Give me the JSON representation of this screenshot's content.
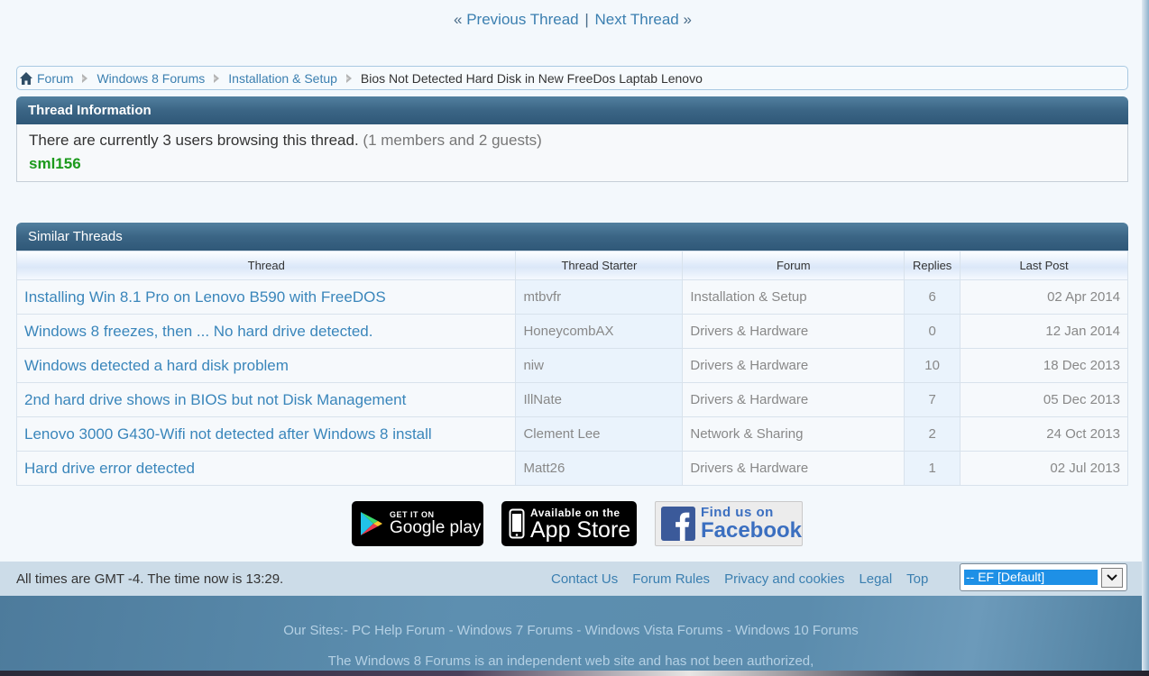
{
  "nav": {
    "prev_prefix": "«",
    "prev_label": "Previous Thread",
    "separator": "|",
    "next_label": "Next Thread",
    "next_suffix": "»"
  },
  "breadcrumb": {
    "items": [
      "Forum",
      "Windows 8 Forums",
      "Installation & Setup"
    ],
    "current": "Bios Not Detected Hard Disk in New FreeDos Laptab Lenovo"
  },
  "thread_info": {
    "title": "Thread Information",
    "browsing_text": "There are currently 3 users browsing this thread.",
    "breakdown": "(1 members and 2 guests)",
    "members": [
      "sml156"
    ]
  },
  "similar_threads": {
    "title": "Similar Threads",
    "columns": [
      "Thread",
      "Thread Starter",
      "Forum",
      "Replies",
      "Last Post"
    ],
    "rows": [
      {
        "thread": "Installing Win 8.1 Pro on Lenovo B590 with FreeDOS",
        "starter": "mtbvfr",
        "forum": "Installation & Setup",
        "replies": "6",
        "last_post": "02 Apr 2014"
      },
      {
        "thread": "Windows 8 freezes, then ... No hard drive detected.",
        "starter": "HoneycombAX",
        "forum": "Drivers & Hardware",
        "replies": "0",
        "last_post": "12 Jan 2014"
      },
      {
        "thread": "Windows detected a hard disk problem",
        "starter": "niw",
        "forum": "Drivers & Hardware",
        "replies": "10",
        "last_post": "18 Dec 2013"
      },
      {
        "thread": "2nd hard drive shows in BIOS but not Disk Management",
        "starter": "IllNate",
        "forum": "Drivers & Hardware",
        "replies": "7",
        "last_post": "05 Dec 2013"
      },
      {
        "thread": "Lenovo 3000 G430-Wifi not detected after Windows 8 install",
        "starter": "Clement Lee",
        "forum": "Network & Sharing",
        "replies": "2",
        "last_post": "24 Oct 2013"
      },
      {
        "thread": "Hard drive error detected",
        "starter": "Matt26",
        "forum": "Drivers & Hardware",
        "replies": "1",
        "last_post": "02 Jul 2013"
      }
    ]
  },
  "badges": {
    "google_play": {
      "small": "GET IT ON",
      "big": "Google play"
    },
    "app_store": {
      "small": "Available on the",
      "big": "App Store"
    },
    "facebook": {
      "small": "Find us on",
      "big": "Facebook"
    }
  },
  "footer": {
    "time_text": "All times are GMT -4. The time now is 13:29.",
    "links": [
      "Contact Us",
      "Forum Rules",
      "Privacy and cookies",
      "Legal",
      "Top"
    ],
    "style_selected": "-- EF [Default]",
    "sites_prefix": "Our Sites:- ",
    "sites": [
      "PC Help Forum",
      "Windows 7 Forums",
      "Windows Vista Forums",
      "Windows 10 Forums"
    ],
    "sites_separator": " - ",
    "disclaimer": "The Windows 8 Forums is an independent web site and has not been authorized,"
  },
  "colors": {
    "link": "#3b7fb0",
    "header_blue": "#3b6585",
    "member_green": "#1c9a1c",
    "select_highlight": "#1e90e6"
  }
}
